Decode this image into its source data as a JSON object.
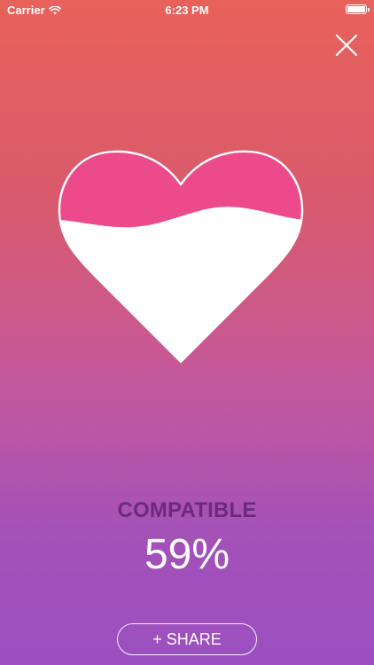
{
  "status_bar": {
    "carrier": "Carrier",
    "time": "6:23 PM",
    "wifi_icon": "wifi-icon",
    "battery_icon": "battery-icon"
  },
  "close_icon": "close-icon",
  "heart": {
    "icon": "heart-icon",
    "fill_color": "#ec4a8b",
    "empty_color": "#ffffff",
    "outline_color": "#ffffff"
  },
  "result": {
    "label": "COMPATIBLE",
    "percent": "59%",
    "label_color": "#6b2a7e"
  },
  "share_button": {
    "label": "+ SHARE"
  }
}
